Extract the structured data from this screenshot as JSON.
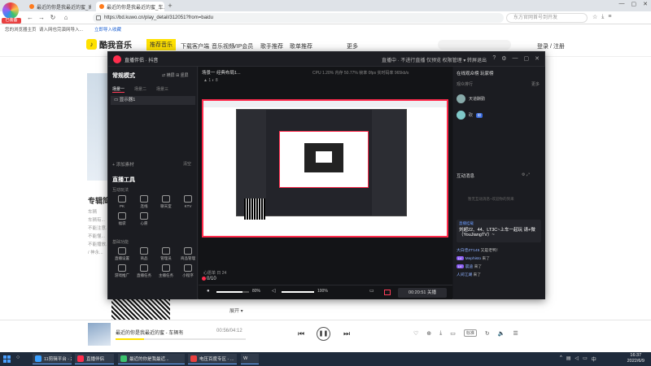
{
  "browser": {
    "tabs": [
      {
        "label": "最近的你是我最近的蜜_高潮..."
      },
      {
        "label": "最近的你是我最近的蜜_车..."
      }
    ],
    "url": "https://bd.kuwo.cn/play_detail/312051?from=baidu",
    "search_placeholder": "东方官网首号到开发",
    "bookmark_1": "您的浏览器主页",
    "bookmark_2": "请入网也完演网导入...",
    "bookmark_3": "立即导入收藏",
    "logo_label": "已装备"
  },
  "kuwo": {
    "brand": "酷我音乐",
    "nav": [
      "推荐音乐",
      "下载客户端",
      "音乐视频",
      "VIP会员",
      "歌手推荐",
      "歌单推荐",
      "更多"
    ],
    "login": "登录 / 注册",
    "album_heading": "专辑简",
    "lyric_lines": [
      "车辆",
      "车辆有...",
      "不能注意...",
      "不能懂...",
      "不能播放...",
      "/ 神永..."
    ],
    "expand": "展开 ▾"
  },
  "player": {
    "title": "最近的你是我最近的蜜 - 车辆有",
    "time": "00:56/04:12",
    "progress": 0.22,
    "mode": "标准"
  },
  "studio": {
    "app_name": "直播伴侣 · 抖音",
    "headline": "直播中 · 不进行直播  仅预览    权限管理 ▾   转屏退出",
    "mode_title": "常规模式",
    "mode_right": "⇄ 横屏  ⊞ 竖屏",
    "scene_tabs": [
      "场景一",
      "场景二",
      "场景三"
    ],
    "scene_item": "显示器1",
    "add_source": "+ 添加素材",
    "clear": "清空",
    "tools_title": "直播工具",
    "section_live": "互动玩法",
    "section_basic": "基础功能",
    "tools_row1": [
      "PK",
      "连线",
      "聊天室",
      "KTV"
    ],
    "tools_row2": [
      "福袋",
      "心愿"
    ],
    "tools_row3": [
      "直播设置",
      "商品",
      "管理员",
      "商品管理"
    ],
    "tools_row4": [
      "游戏推广",
      "直播任务",
      "主播任务",
      "小程序"
    ],
    "canvas_scene": "场景一  经典布局1...",
    "stats": "CPU 1.20%   内存 50.77%   帧率 0fps   实时码率 965kb/s",
    "pk_label": "心愿单  日  24",
    "pk_value": "0/10",
    "mic_pct": "80%",
    "spk_pct": "100%",
    "stop_label": "00:20:51  关播",
    "audience_title": "在线观众榜  玩家榜",
    "audience_tag": "观众排行",
    "audience_tag_right": "更多",
    "viewers": [
      {
        "name": "天道酬勤",
        "badge": ""
      },
      {
        "name": "砍",
        "badge": "粉"
      }
    ],
    "interact_title": "互动消息",
    "empty_hint": "暂无互动消息~欢迎你的到来",
    "chat_tag": "直播挂载",
    "chat_text": "刘超22、44、LT3C~上车一起玩 请+微（YouJiangTV）~",
    "chat_lines": [
      {
        "name": "大白佳ZT145",
        "text": "又是老鸭！"
      },
      {
        "name": "Mephisto",
        "text": "来了"
      },
      {
        "name": "晨迪",
        "text": "来了"
      },
      {
        "name": "人间江湖",
        "text": "来了"
      }
    ]
  },
  "taskbar": {
    "items": [
      "11剪辑平台 - 2.0.2...",
      "直播伴侣",
      "最近的你是我最近...",
      "电压百度专区 - ...",
      "W"
    ],
    "time": "16:37",
    "date": "2022/6/9"
  }
}
